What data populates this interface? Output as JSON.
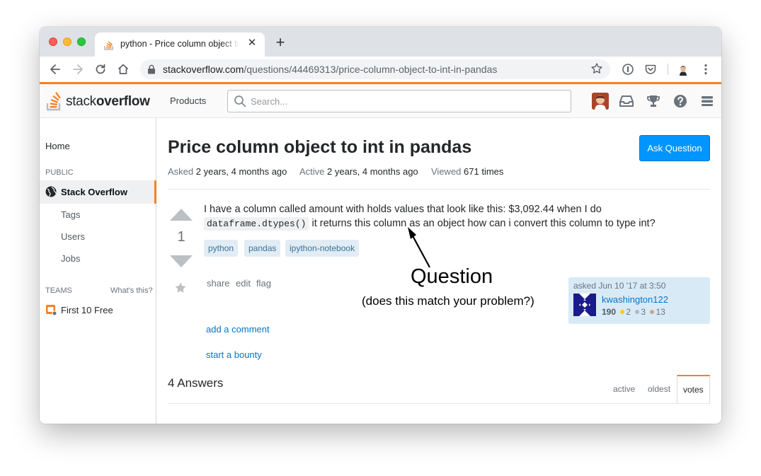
{
  "browser": {
    "tab_title": "python - Price column object to int in pandas | Stack Overflow",
    "url_host": "stackoverflow.com",
    "url_path": "/questions/44469313/price-column-object-to-int-in-pandas"
  },
  "header": {
    "logo_light": "stack",
    "logo_bold": "overflow",
    "products_label": "Products",
    "search_placeholder": "Search..."
  },
  "sidebar": {
    "home": "Home",
    "public_label": "PUBLIC",
    "active_item": "Stack Overflow",
    "items": [
      "Tags",
      "Users",
      "Jobs"
    ],
    "teams_label": "TEAMS",
    "whats_this": "What's this?",
    "teams_item": "First 10 Free"
  },
  "question": {
    "title": "Price column object to int in pandas",
    "ask_button": "Ask Question",
    "asked_label": "Asked",
    "asked_value": "2 years, 4 months ago",
    "active_label": "Active",
    "active_value": "2 years, 4 months ago",
    "viewed_label": "Viewed",
    "viewed_value": "671 times",
    "votes": "1",
    "body_part1": "I have a column called amount with holds values that look like this: $3,092.44 when I do",
    "code": "dataframe.dtypes()",
    "body_part2": " it returns this column as an object how can i convert this column to type int?",
    "tags": [
      "python",
      "pandas",
      "ipython-notebook"
    ],
    "menu": [
      "share",
      "edit",
      "flag"
    ],
    "add_comment": "add a comment",
    "start_bounty": "start a bounty"
  },
  "owner": {
    "asked_time": "asked Jun 10 '17 at 3:50",
    "name": "kwashington122",
    "reputation": "190",
    "gold": "2",
    "silver": "3",
    "bronze": "13"
  },
  "annotation": {
    "title": "Question",
    "subtitle": "(does this match your problem?)"
  },
  "answers": {
    "heading": "4 Answers",
    "sort_tabs": [
      "active",
      "oldest",
      "votes"
    ]
  },
  "colors": {
    "accent": "#f48024",
    "link": "#0077cc",
    "button": "#0095ff",
    "tag_bg": "#e1ecf4"
  }
}
